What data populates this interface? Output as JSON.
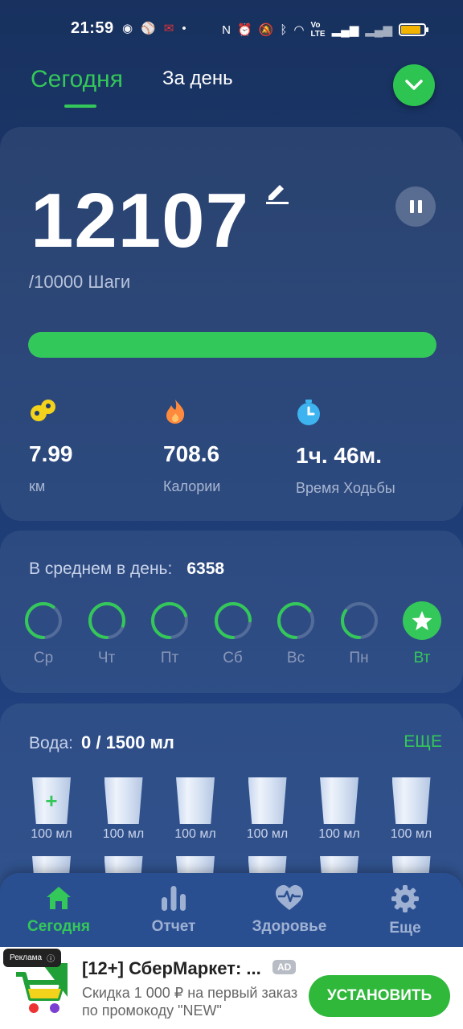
{
  "status_bar": {
    "time": "21:59",
    "battery_level": 0.85,
    "battery_color": "#f2b400"
  },
  "header": {
    "tab_today": "Сегодня",
    "tab_day": "За день",
    "check_icon": "chevron-down-icon"
  },
  "steps": {
    "count": "12107",
    "goal_label": "/10000 Шаги",
    "progress": 1.0,
    "progress_color": "#33c85a"
  },
  "stats": [
    {
      "icon": "footprints-icon",
      "value": "7.99",
      "label": "км",
      "color": "#f2d21b"
    },
    {
      "icon": "flame-icon",
      "value": "708.6",
      "label": "Калории",
      "color": "#ff8a3d"
    },
    {
      "icon": "stopwatch-icon",
      "value": "1ч. 46м.",
      "label": "Время Ходьбы",
      "color": "#3db4f0"
    }
  ],
  "average": {
    "label": "В среднем в день:",
    "value": "6358"
  },
  "days": [
    {
      "label": "Ср",
      "progress": 0.6
    },
    {
      "label": "Чт",
      "progress": 0.8
    },
    {
      "label": "Пт",
      "progress": 0.7
    },
    {
      "label": "Сб",
      "progress": 0.75
    },
    {
      "label": "Вс",
      "progress": 0.65
    },
    {
      "label": "Пн",
      "progress": 0.35
    },
    {
      "label": "Вт",
      "progress": 1.0,
      "current": true
    }
  ],
  "water": {
    "label": "Вода:",
    "value": "0 / 1500 мл",
    "more": "ЕЩЕ",
    "cups": [
      "100 мл",
      "100 мл",
      "100 мл",
      "100 мл",
      "100 мл",
      "100 мл"
    ],
    "add_icon": "+"
  },
  "nav": [
    {
      "label": "Сегодня",
      "icon": "home-icon",
      "active": true
    },
    {
      "label": "Отчет",
      "icon": "bar-chart-icon"
    },
    {
      "label": "Здоровье",
      "icon": "heart-pulse-icon"
    },
    {
      "label": "Еще",
      "icon": "gear-icon"
    }
  ],
  "ad": {
    "badge": "Реклама",
    "title": "[12+] СберМаркет: ...",
    "tag": "AD",
    "description": "Скидка 1 000 ₽ на первый заказ по промокоду \"NEW\"",
    "button": "УСТАНОВИТЬ"
  },
  "colors": {
    "accent": "#34c759",
    "background": "#1d3b72"
  }
}
